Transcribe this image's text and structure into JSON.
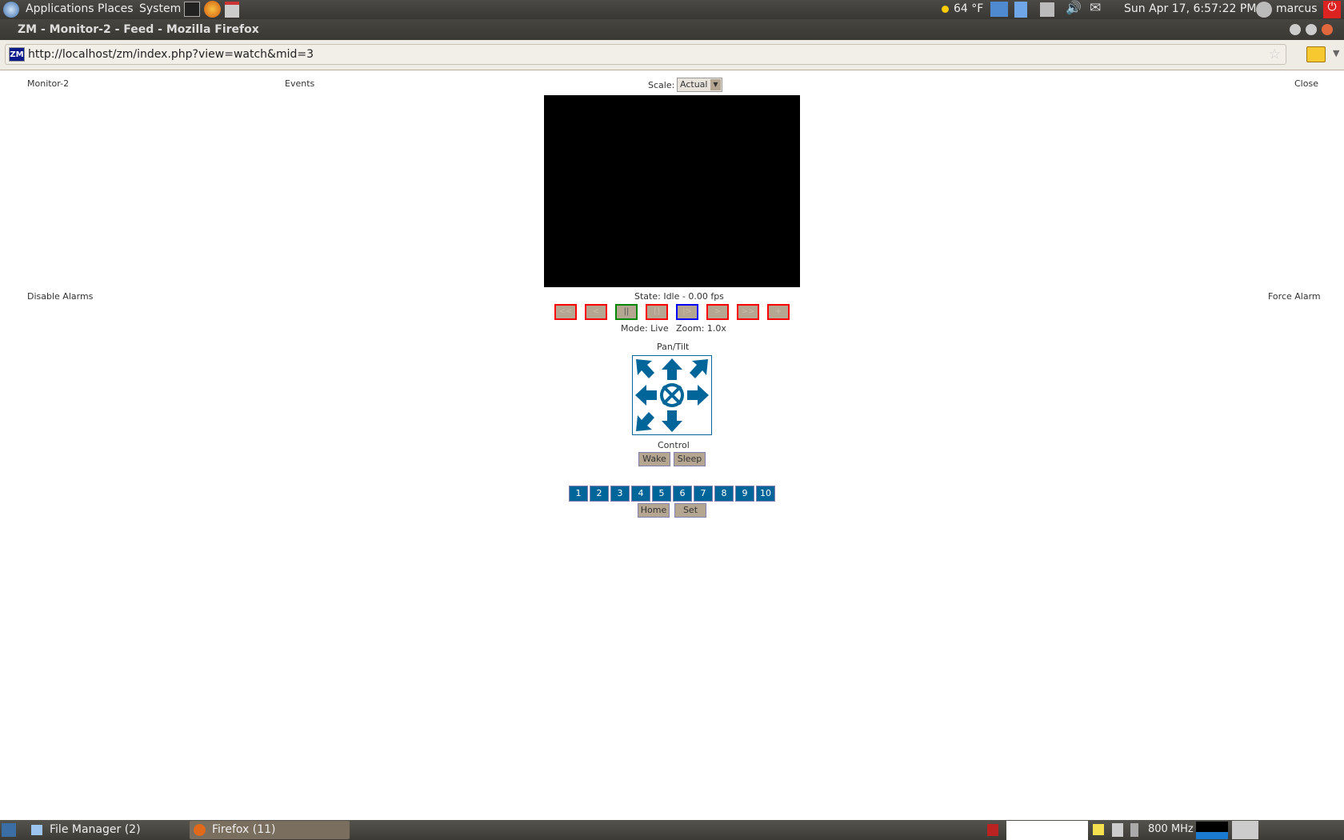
{
  "top_panel": {
    "menus": [
      "Applications",
      "Places",
      "System"
    ],
    "weather": "64 °F",
    "clock": "Sun Apr 17,  6:57:22 PM",
    "user": "marcus"
  },
  "window": {
    "title": "ZM - Monitor-2 - Feed - Mozilla Firefox"
  },
  "browser": {
    "url": "http://localhost/zm/index.php?view=watch&mid=3",
    "favicon": "ZM"
  },
  "page": {
    "monitor_name": "Monitor-2",
    "events_link": "Events",
    "scale_label": "Scale:",
    "scale_value": "Actual",
    "close_link": "Close",
    "disable_alarms": "Disable Alarms",
    "force_alarm": "Force Alarm",
    "state": "State: Idle - 0.00 fps",
    "stream_controls": [
      "<<",
      "<",
      "||",
      "[]",
      "|>",
      ">",
      ">>",
      "+"
    ],
    "mode": "Mode: Live",
    "zoom": "Zoom: 1.0x",
    "pantilt_label": "Pan/Tilt",
    "control_label": "Control",
    "wake": "Wake",
    "sleep": "Sleep",
    "presets": [
      "1",
      "2",
      "3",
      "4",
      "5",
      "6",
      "7",
      "8",
      "9",
      "10"
    ],
    "home": "Home",
    "set": "Set"
  },
  "taskbar": {
    "items": [
      "File Manager (2)",
      "Firefox (11)"
    ],
    "cpu": "800 MHz"
  },
  "colors": {
    "accent": "#006699",
    "button_bg": "#b5a691",
    "link": "#7a7ac0"
  }
}
